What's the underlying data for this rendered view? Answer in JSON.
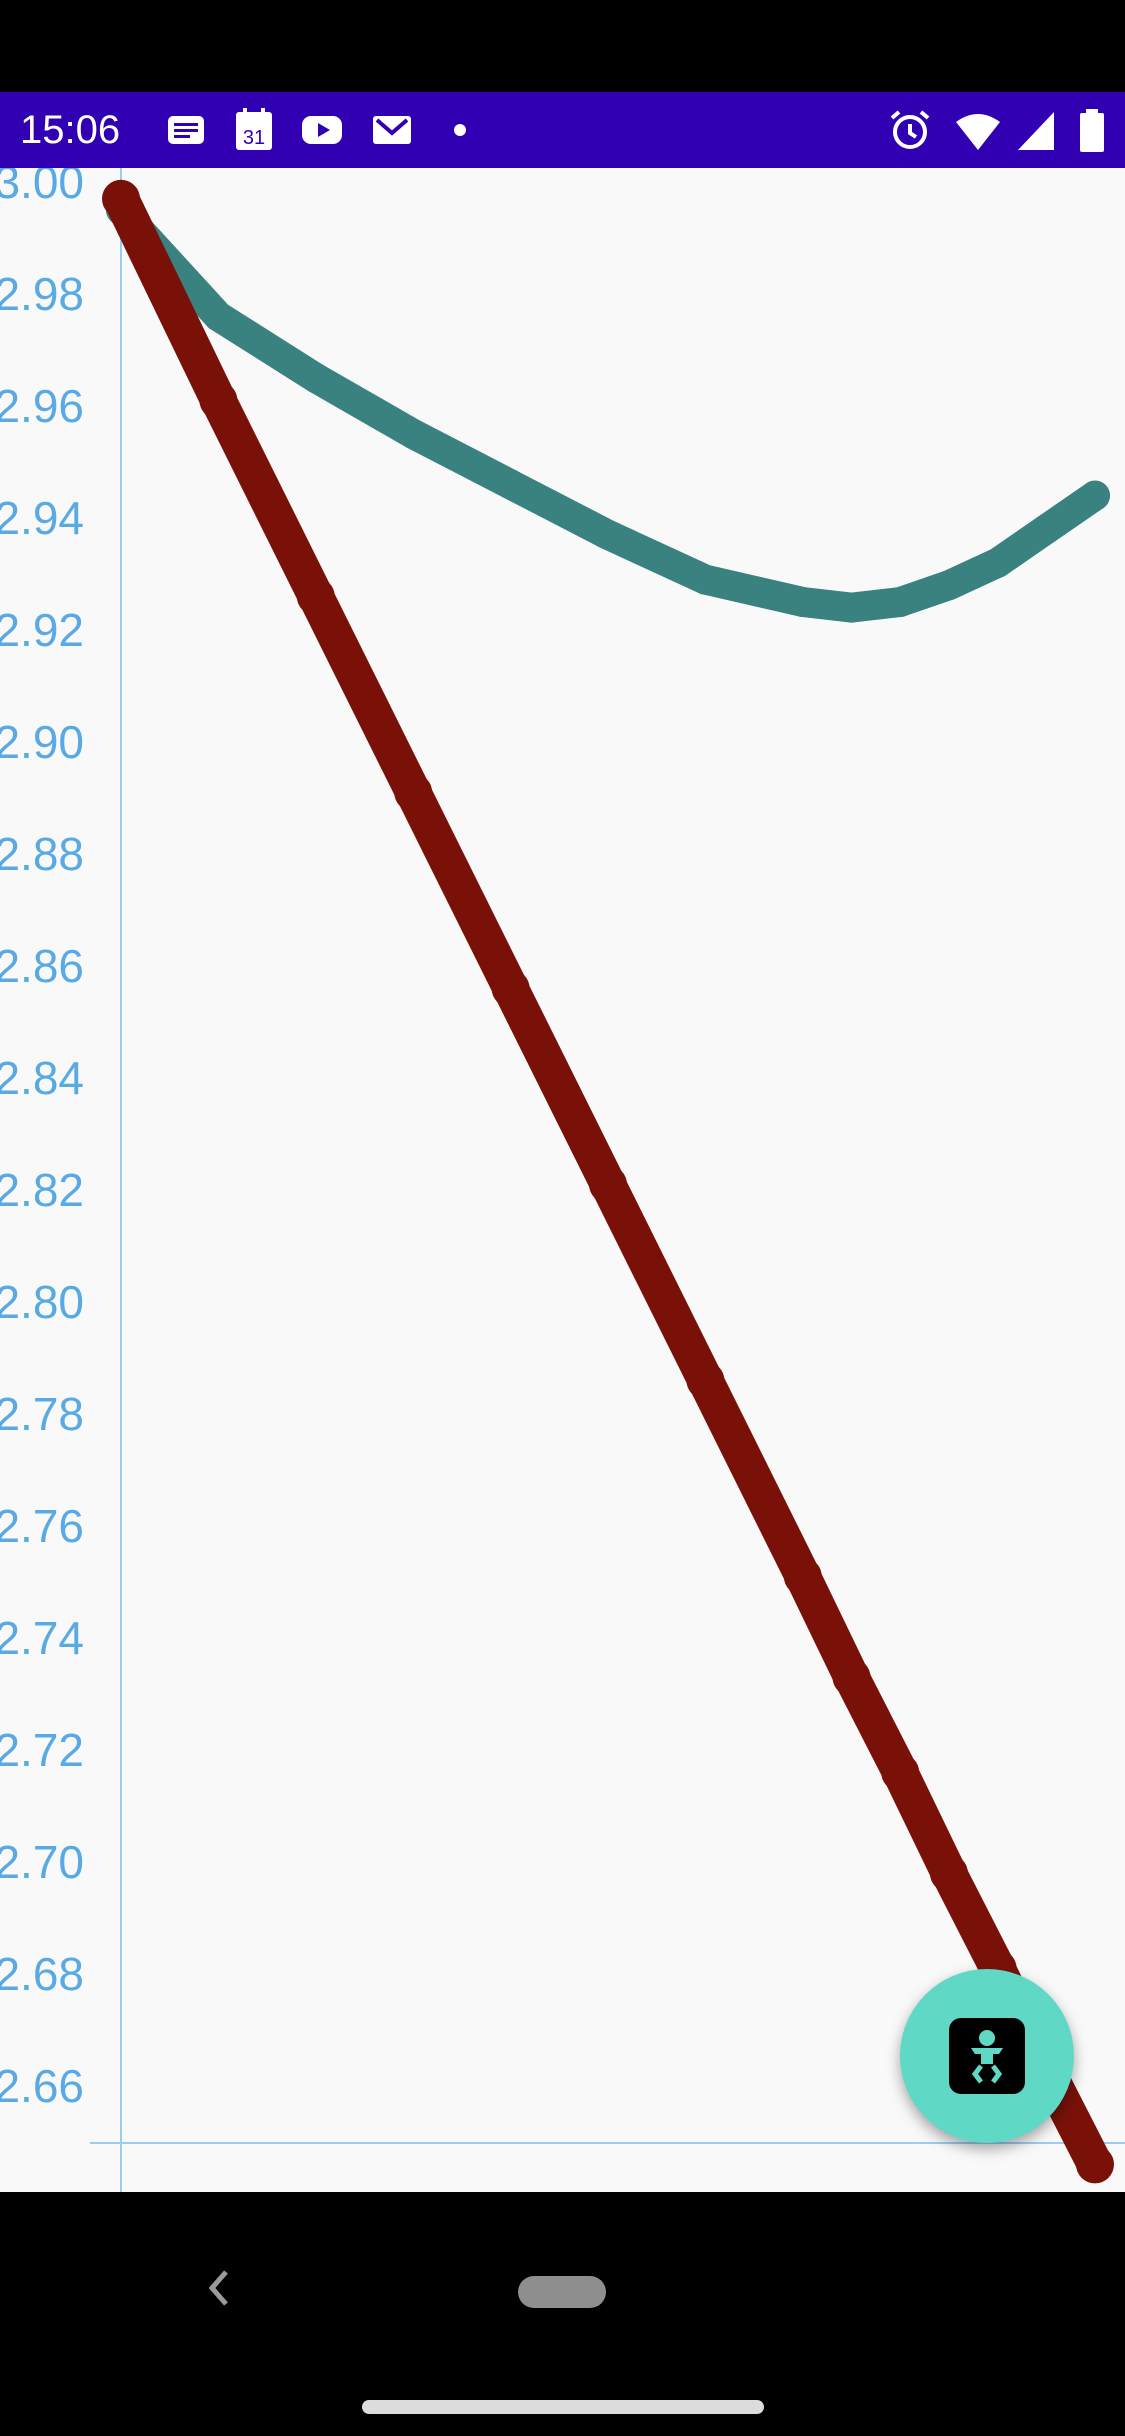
{
  "status_bar": {
    "time": "15:06",
    "background": "#3200b3",
    "left_icons": [
      "notes-icon",
      "calendar-icon",
      "youtube-icon",
      "gmail-icon",
      "dot-icon"
    ],
    "calendar_day": "31",
    "right_icons": [
      "alarm-icon",
      "wifi-icon",
      "cellular-icon",
      "battery-icon"
    ]
  },
  "chart_data": {
    "type": "line",
    "title": "",
    "xlabel": "",
    "ylabel": "",
    "ylim": [
      2.645,
      3.0
    ],
    "y_ticks": [
      "3.00",
      "2.98",
      "2.96",
      "2.94",
      "2.92",
      "2.90",
      "2.88",
      "2.86",
      "2.84",
      "2.82",
      "2.80",
      "2.78",
      "2.76",
      "2.74",
      "2.72",
      "2.70",
      "2.68",
      "2.66"
    ],
    "grid": false,
    "x": [
      0,
      0.1,
      0.2,
      0.3,
      0.4,
      0.5,
      0.6,
      0.7,
      0.75,
      0.8,
      0.85,
      0.9,
      0.95,
      1.0
    ],
    "series": [
      {
        "color": "#3a8280",
        "values": [
          2.995,
          2.976,
          2.965,
          2.955,
          2.946,
          2.937,
          2.929,
          2.925,
          2.924,
          2.925,
          2.928,
          2.932,
          2.938,
          2.944
        ]
      },
      {
        "color": "#7a1109",
        "values": [
          2.997,
          2.961,
          2.926,
          2.891,
          2.856,
          2.821,
          2.786,
          2.751,
          2.733,
          2.716,
          2.698,
          2.681,
          2.663,
          2.646
        ]
      }
    ]
  },
  "fab": {
    "icon": "baby-icon",
    "background": "#5fd9c6"
  },
  "nav_bar": {
    "icons": [
      "back-icon",
      "home-pill",
      "gesture-bar"
    ]
  }
}
